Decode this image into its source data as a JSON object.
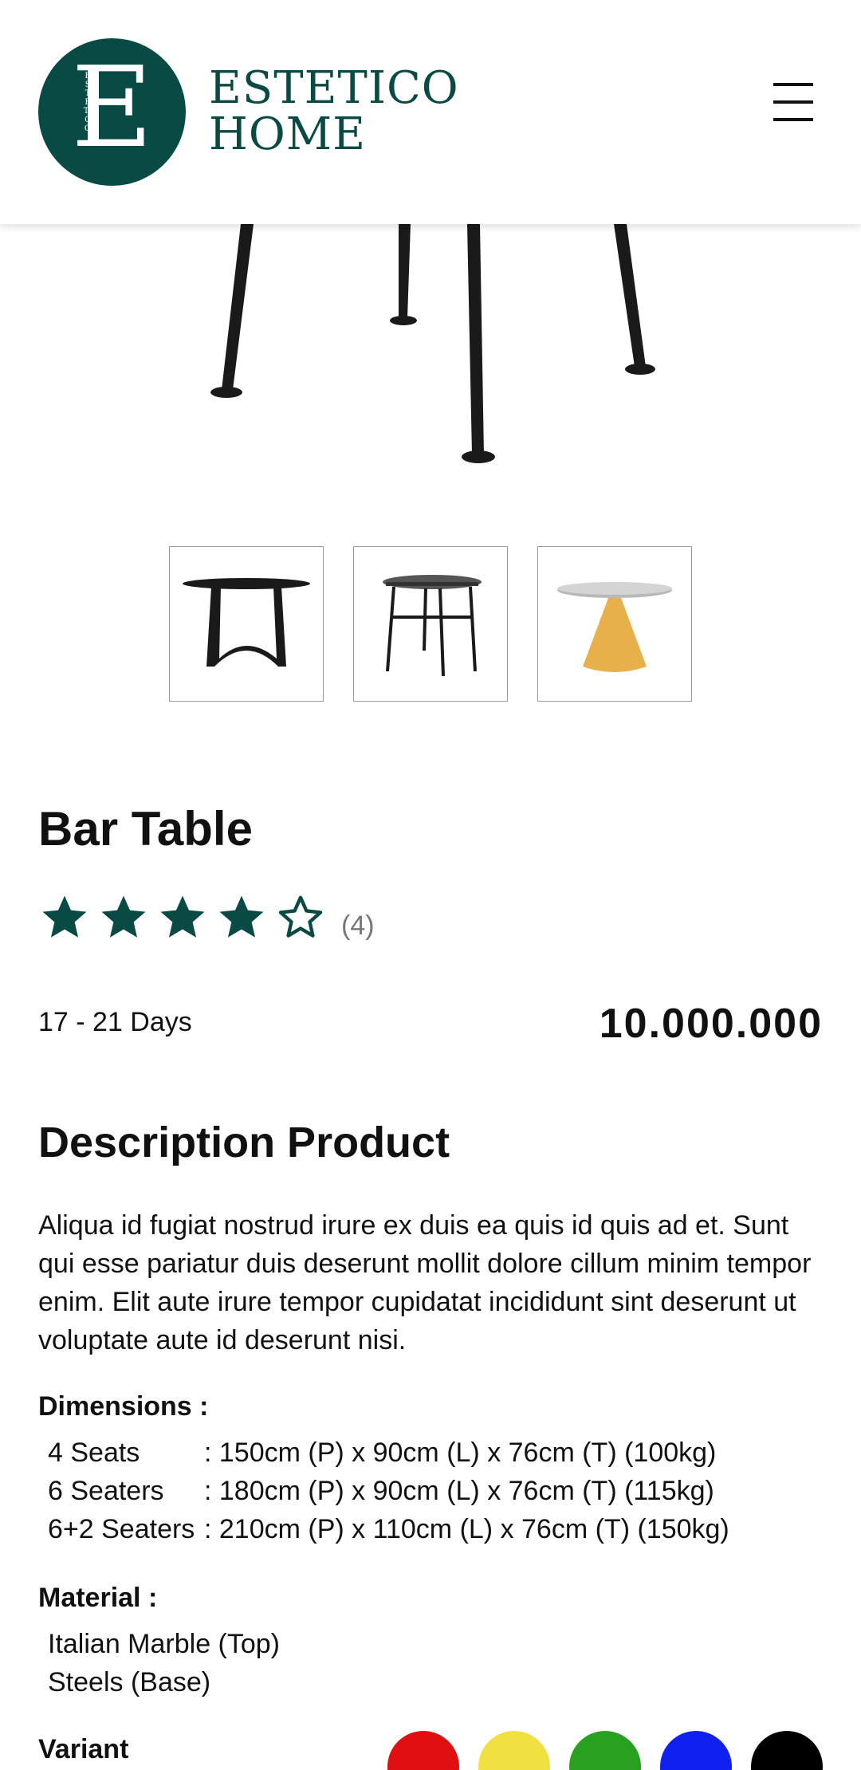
{
  "header": {
    "logo_letter": "E",
    "logo_vertical_text": "ESTETICO",
    "brand_line1": "ESTETICO",
    "brand_line2": "HOME",
    "menu_icon": "hamburger-menu-icon"
  },
  "product": {
    "title": "Bar Table",
    "rating": 4,
    "rating_max": 5,
    "review_count": "(4)",
    "delivery": "17 - 21 Days",
    "price": "10.000.000"
  },
  "description": {
    "title": "Description Product",
    "text": "Aliqua id fugiat nostrud irure ex duis ea quis id quis ad et. Sunt qui esse pariatur duis deserunt mollit dolore cillum minim tempor enim. Elit aute irure tempor cupidatat incididunt sint deserunt ut voluptate aute id deserunt nisi."
  },
  "dimensions": {
    "label": "Dimensions :",
    "rows": [
      {
        "name": "4 Seats",
        "value": ": 150cm (P) x 90cm (L) x 76cm (T) (100kg)"
      },
      {
        "name": "6 Seaters",
        "value": ": 180cm (P) x 90cm (L) x 76cm (T) (115kg)"
      },
      {
        "name": "6+2 Seaters",
        "value": ": 210cm (P) x 110cm (L) x 76cm (T) (150kg)"
      }
    ]
  },
  "material": {
    "label": "Material :",
    "items": [
      "Italian Marble (Top)",
      "Steels (Base)"
    ]
  },
  "variant": {
    "label": "Variant",
    "colors": [
      "#e01010",
      "#f0e040",
      "#28a020",
      "#1020f0",
      "#000000"
    ]
  },
  "colors": {
    "brand": "#0a4a44",
    "star": "#0a4a44"
  }
}
